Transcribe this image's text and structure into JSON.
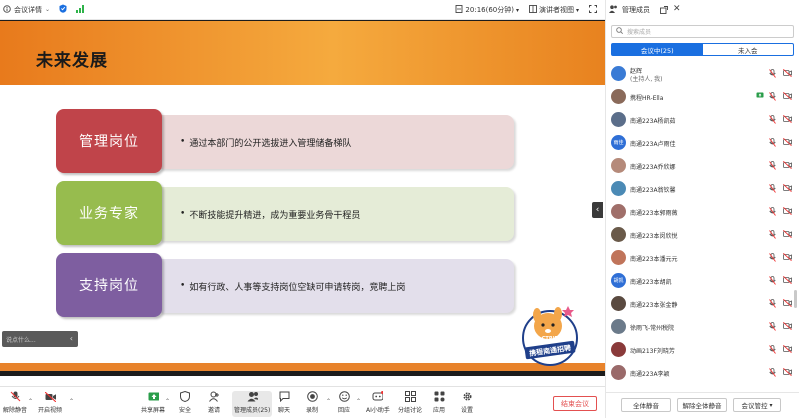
{
  "topbar": {
    "meeting_info": "会议详情",
    "time": "20:16(60分钟)",
    "view_mode": "演讲者视图"
  },
  "slide": {
    "title": "未来发展",
    "rows": [
      {
        "label": "管理岗位",
        "text": "通过本部门的公开选拔进入管理储备梯队",
        "label_color": "#c0444a",
        "bg_color": "#ecd8d8"
      },
      {
        "label": "业务专家",
        "text": "不断技能提升精进，成为重要业务骨干程员",
        "label_color": "#97bc4e",
        "bg_color": "#e5ecd7"
      },
      {
        "label": "支持岗位",
        "text": "如有行政、人事等支持岗位空缺可申请转岗，竞聘上岗",
        "label_color": "#7e5ea0",
        "bg_color": "#e3dfeb"
      }
    ],
    "mascot_text": "携程南通招聘",
    "mascot_brand": "CTRIP"
  },
  "chat": {
    "placeholder": "说点什么..."
  },
  "toolbar": {
    "items": [
      "解除静音",
      "开启视频",
      "共享屏幕",
      "安全",
      "邀请",
      "管理成员(25)",
      "聊天",
      "录制",
      "回应",
      "AI小助手",
      "分组讨论",
      "应用",
      "设置"
    ],
    "end_label": "结束会议"
  },
  "panel": {
    "title": "管理成员",
    "search_placeholder": "搜索成员",
    "tab_in": "会议中(25)",
    "tab_out": "未入会",
    "members": [
      {
        "name": "赵辉",
        "sub": "(主持人, 我)",
        "avatar": "",
        "color": "#3a7bd5"
      },
      {
        "name": "携程HR-Ella",
        "avatar": "",
        "color": "#8a6a5a",
        "sharing": true
      },
      {
        "name": "南通223A杨凯茹",
        "avatar": "",
        "color": "#5b6e8a"
      },
      {
        "name": "南通223A卢雨佳",
        "avatar": "雨佳",
        "color": "#2f6fd6"
      },
      {
        "name": "南通223A乔欣娜",
        "avatar": "",
        "color": "#b58a7a"
      },
      {
        "name": "南通223A翁钦馨",
        "avatar": "",
        "color": "#4b8ab5"
      },
      {
        "name": "南通223本郭雨薇",
        "avatar": "",
        "color": "#a06f6a"
      },
      {
        "name": "南通223本闵欣悦",
        "avatar": "",
        "color": "#6a5a4a"
      },
      {
        "name": "南通223本潘元元",
        "avatar": "",
        "color": "#c0745a"
      },
      {
        "name": "南通223本胡凯",
        "avatar": "胡凯",
        "color": "#2f6fd6"
      },
      {
        "name": "南通223本张金静",
        "avatar": "",
        "color": "#5a4a40"
      },
      {
        "name": "徐雨飞-常州税院",
        "avatar": "",
        "color": "#6b7a8a"
      },
      {
        "name": "动画213F刘晓芳",
        "avatar": "",
        "color": "#8a3a3a"
      },
      {
        "name": "南通223A李颖",
        "avatar": "",
        "color": "#9a6a6a"
      }
    ],
    "mute_all": "全体静音",
    "unmute_all": "解除全体静音",
    "control": "会议管控"
  }
}
